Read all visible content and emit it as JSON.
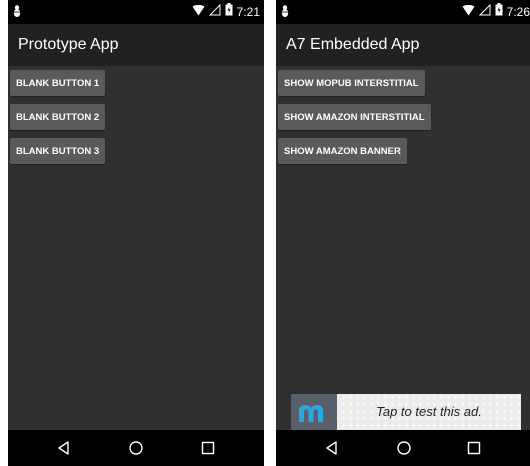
{
  "screens": [
    {
      "status": {
        "time": "7:21"
      },
      "app_title": "Prototype App",
      "buttons": [
        "BLANK BUTTON 1",
        "BLANK BUTTON 2",
        "BLANK BUTTON 3"
      ]
    },
    {
      "status": {
        "time": "7:26"
      },
      "app_title": "A7 Embedded App",
      "buttons": [
        "SHOW MOPUB INTERSTITIAL",
        "SHOW AMAZON INTERSTITIAL",
        "SHOW AMAZON BANNER"
      ],
      "ad_banner": {
        "text": "Tap to test this ad."
      }
    }
  ],
  "icons": {
    "status_left": "android-debug-icon",
    "wifi": "wifi-icon",
    "signal": "signal-icon",
    "battery": "battery-icon",
    "nav_back": "back-icon",
    "nav_home": "home-icon",
    "nav_recents": "recents-icon",
    "ad_logo": "mopub-logo-icon"
  },
  "colors": {
    "statusbar": "#000000",
    "actionbar": "#212121",
    "background": "#303030",
    "button": "#5a5a5a",
    "ad_logo": "#2aa8e0"
  }
}
